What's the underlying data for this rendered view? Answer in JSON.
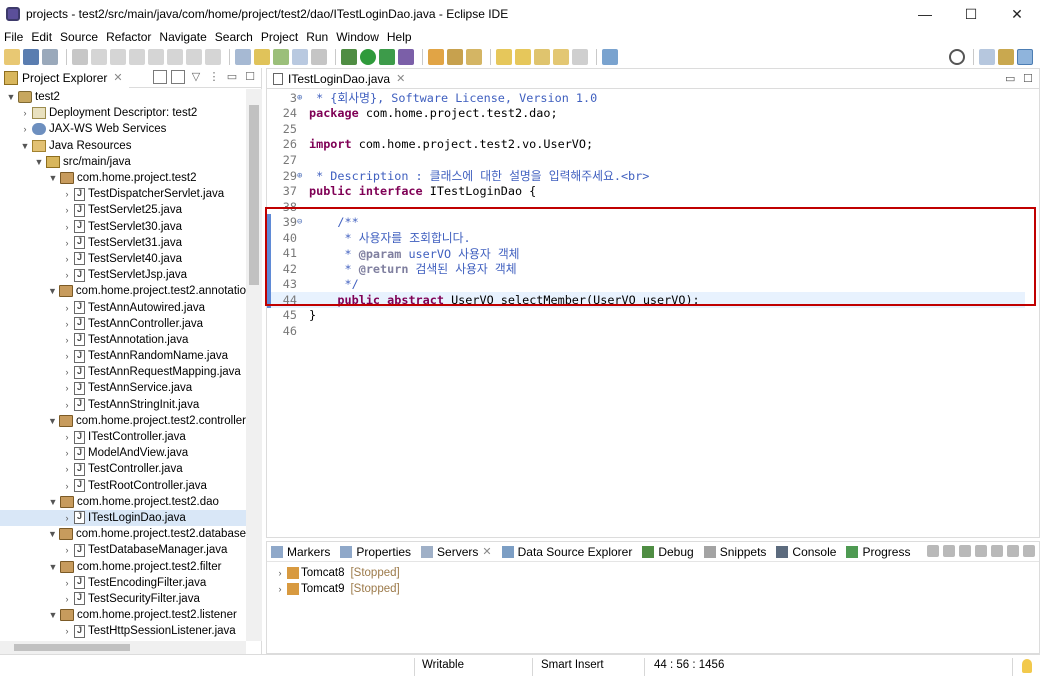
{
  "window": {
    "title": "projects - test2/src/main/java/com/home/project/test2/dao/ITestLoginDao.java - Eclipse IDE",
    "minimize": "—",
    "maximize": "☐",
    "close": "✕"
  },
  "menu": [
    "File",
    "Edit",
    "Source",
    "Refactor",
    "Navigate",
    "Search",
    "Project",
    "Run",
    "Window",
    "Help"
  ],
  "project_explorer": {
    "title": "Project Explorer",
    "tree": [
      {
        "indent": 0,
        "twisty": "▼",
        "icon": "project",
        "label": "test2"
      },
      {
        "indent": 1,
        "twisty": "›",
        "icon": "dd",
        "label": "Deployment Descriptor: test2"
      },
      {
        "indent": 1,
        "twisty": "›",
        "icon": "jaxws",
        "label": "JAX-WS Web Services"
      },
      {
        "indent": 1,
        "twisty": "▼",
        "icon": "jres",
        "label": "Java Resources"
      },
      {
        "indent": 2,
        "twisty": "▼",
        "icon": "src",
        "label": "src/main/java"
      },
      {
        "indent": 3,
        "twisty": "▼",
        "icon": "pkg",
        "label": "com.home.project.test2"
      },
      {
        "indent": 4,
        "twisty": "›",
        "icon": "java",
        "label": "TestDispatcherServlet.java"
      },
      {
        "indent": 4,
        "twisty": "›",
        "icon": "java",
        "label": "TestServlet25.java"
      },
      {
        "indent": 4,
        "twisty": "›",
        "icon": "java",
        "label": "TestServlet30.java"
      },
      {
        "indent": 4,
        "twisty": "›",
        "icon": "java",
        "label": "TestServlet31.java"
      },
      {
        "indent": 4,
        "twisty": "›",
        "icon": "java",
        "label": "TestServlet40.java"
      },
      {
        "indent": 4,
        "twisty": "›",
        "icon": "java",
        "label": "TestServletJsp.java"
      },
      {
        "indent": 3,
        "twisty": "▼",
        "icon": "pkg",
        "label": "com.home.project.test2.annotation"
      },
      {
        "indent": 4,
        "twisty": "›",
        "icon": "java",
        "label": "TestAnnAutowired.java"
      },
      {
        "indent": 4,
        "twisty": "›",
        "icon": "java",
        "label": "TestAnnController.java"
      },
      {
        "indent": 4,
        "twisty": "›",
        "icon": "java",
        "label": "TestAnnotation.java"
      },
      {
        "indent": 4,
        "twisty": "›",
        "icon": "java",
        "label": "TestAnnRandomName.java"
      },
      {
        "indent": 4,
        "twisty": "›",
        "icon": "java",
        "label": "TestAnnRequestMapping.java"
      },
      {
        "indent": 4,
        "twisty": "›",
        "icon": "java",
        "label": "TestAnnService.java"
      },
      {
        "indent": 4,
        "twisty": "›",
        "icon": "java",
        "label": "TestAnnStringInit.java"
      },
      {
        "indent": 3,
        "twisty": "▼",
        "icon": "pkg",
        "label": "com.home.project.test2.controller"
      },
      {
        "indent": 4,
        "twisty": "›",
        "icon": "java",
        "label": "ITestController.java"
      },
      {
        "indent": 4,
        "twisty": "›",
        "icon": "java",
        "label": "ModelAndView.java"
      },
      {
        "indent": 4,
        "twisty": "›",
        "icon": "java",
        "label": "TestController.java"
      },
      {
        "indent": 4,
        "twisty": "›",
        "icon": "java",
        "label": "TestRootController.java"
      },
      {
        "indent": 3,
        "twisty": "▼",
        "icon": "pkg",
        "label": "com.home.project.test2.dao"
      },
      {
        "indent": 4,
        "twisty": "›",
        "icon": "java",
        "label": "ITestLoginDao.java",
        "selected": true
      },
      {
        "indent": 3,
        "twisty": "▼",
        "icon": "pkg",
        "label": "com.home.project.test2.database"
      },
      {
        "indent": 4,
        "twisty": "›",
        "icon": "java",
        "label": "TestDatabaseManager.java"
      },
      {
        "indent": 3,
        "twisty": "▼",
        "icon": "pkg",
        "label": "com.home.project.test2.filter"
      },
      {
        "indent": 4,
        "twisty": "›",
        "icon": "java",
        "label": "TestEncodingFilter.java"
      },
      {
        "indent": 4,
        "twisty": "›",
        "icon": "java",
        "label": "TestSecurityFilter.java"
      },
      {
        "indent": 3,
        "twisty": "▼",
        "icon": "pkg",
        "label": "com.home.project.test2.listener"
      },
      {
        "indent": 4,
        "twisty": "›",
        "icon": "java",
        "label": "TestHttpSessionListener.java"
      }
    ]
  },
  "editor": {
    "tab_label": "ITestLoginDao.java",
    "lines": [
      {
        "num": "3",
        "fold": "⊕",
        "mark": false,
        "html": "<span class=\"cm\"> * {회사명}, Software License, Version 1.0</span>"
      },
      {
        "num": "24",
        "fold": "",
        "mark": false,
        "html": "<span class=\"kw\">package</span> com.home.project.test2.dao;"
      },
      {
        "num": "25",
        "fold": "",
        "mark": false,
        "html": ""
      },
      {
        "num": "26",
        "fold": "",
        "mark": false,
        "html": "<span class=\"kw\">import</span> com.home.project.test2.vo.UserVO;"
      },
      {
        "num": "27",
        "fold": "",
        "mark": false,
        "html": ""
      },
      {
        "num": "29",
        "fold": "⊕",
        "mark": false,
        "html": "<span class=\"cm\"> * Description : 클래스에 대한 설명을 입력해주세요.&lt;br&gt;</span>"
      },
      {
        "num": "37",
        "fold": "",
        "mark": false,
        "html": "<span class=\"kw\">public interface</span> ITestLoginDao {"
      },
      {
        "num": "38",
        "fold": "",
        "mark": false,
        "html": ""
      },
      {
        "num": "39",
        "fold": "⊖",
        "mark": true,
        "html": "    <span class=\"cm\">/**</span>"
      },
      {
        "num": "40",
        "fold": "",
        "mark": true,
        "html": "<span class=\"cm\">     * 사용자를 조회합니다.</span>"
      },
      {
        "num": "41",
        "fold": "",
        "mark": true,
        "html": "<span class=\"cm\">     * </span><span class=\"tag\">@param</span><span class=\"cm\"> userVO 사용자 객체</span>"
      },
      {
        "num": "42",
        "fold": "",
        "mark": true,
        "html": "<span class=\"cm\">     * </span><span class=\"tag\">@return</span><span class=\"cm\"> 검색된 사용자 객체</span>"
      },
      {
        "num": "43",
        "fold": "",
        "mark": true,
        "html": "<span class=\"cm\">     */</span>"
      },
      {
        "num": "44",
        "fold": "",
        "mark": true,
        "html": "    <span class=\"kw\">public abstract</span> UserVO selectMember(UserVO userVO);",
        "current": true
      },
      {
        "num": "45",
        "fold": "",
        "mark": false,
        "html": "}"
      },
      {
        "num": "46",
        "fold": "",
        "mark": false,
        "html": ""
      }
    ]
  },
  "bottom": {
    "tabs": [
      "Markers",
      "Properties",
      "Servers",
      "Data Source Explorer",
      "Debug",
      "Snippets",
      "Console",
      "Progress"
    ],
    "servers": [
      {
        "name": "Tomcat8",
        "state": "[Stopped]"
      },
      {
        "name": "Tomcat9",
        "state": "[Stopped]"
      }
    ]
  },
  "status": {
    "writable": "Writable",
    "insert_mode": "Smart Insert",
    "position": "44 : 56 : 1456"
  }
}
